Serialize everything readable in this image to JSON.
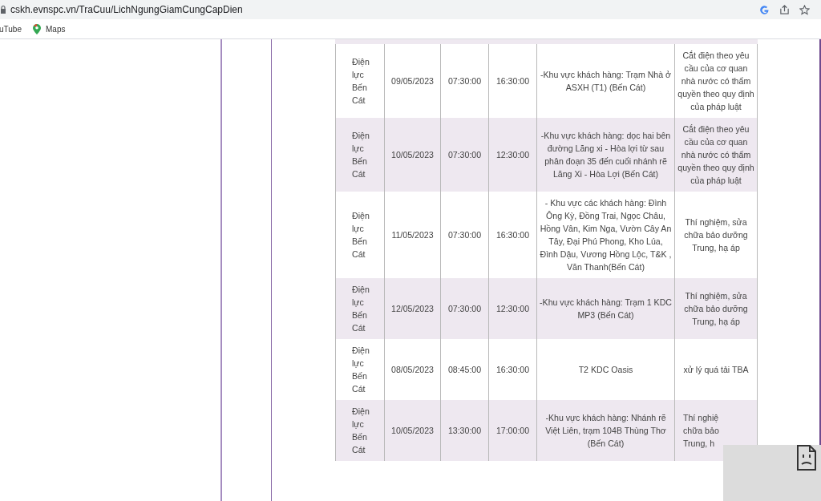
{
  "browser": {
    "url": "cskh.evnspc.vn/TraCuu/LichNgungGiamCungCapDien",
    "bookmarks": [
      {
        "label": "uTube",
        "kind": "plain"
      },
      {
        "label": "Maps",
        "kind": "maps"
      }
    ]
  },
  "table": {
    "rows": [
      {
        "unit": "Điện lực Bến Cát",
        "date": "09/05/2023",
        "start": "07:30:00",
        "end": "16:30:00",
        "area": "-Khu vực khách hàng: Trạm Nhà ở ASXH (T1) (Bến Cát)",
        "reason": "Cắt điện theo yêu cầu của cơ quan nhà nước có thẩm quyền theo quy định của pháp luật",
        "shaded": false
      },
      {
        "unit": "Điện lực Bến Cát",
        "date": "10/05/2023",
        "start": "07:30:00",
        "end": "12:30:00",
        "area": "-Khu vực khách hàng: dọc hai bên đường Lăng xi - Hòa lợi từ sau phân đoạn 35 đến cuối nhánh rẽ Lăng Xi - Hòa Lợi (Bến Cát)",
        "reason": "Cắt điện theo yêu cầu của cơ quan nhà nước có thẩm quyền theo quy định của pháp luật",
        "shaded": true
      },
      {
        "unit": "Điện lực Bến Cát",
        "date": "11/05/2023",
        "start": "07:30:00",
        "end": "16:30:00",
        "area": "- Khu vực các khách hàng: Đình Ông Kỳ, Đồng Trai, Ngọc Châu, Hồng Vân, Kim Nga, Vườn Cây An Tây, Đại Phú Phong, Kho Lúa, Đình Dậu, Vương Hồng Lộc, T&K , Văn Thanh(Bến Cát)",
        "reason": "Thí nghiệm, sửa chữa bảo dưỡng Trung, hạ áp",
        "shaded": false
      },
      {
        "unit": "Điện lực Bến Cát",
        "date": "12/05/2023",
        "start": "07:30:00",
        "end": "12:30:00",
        "area": "-Khu vực khách hàng: Trạm 1 KDC MP3 (Bến Cát)",
        "reason": "Thí nghiệm, sửa chữa bảo dưỡng Trung, hạ áp",
        "shaded": true
      },
      {
        "unit": "Điện lực Bến Cát",
        "date": "08/05/2023",
        "start": "08:45:00",
        "end": "16:30:00",
        "area": "T2 KDC Oasis",
        "reason": "xử lý quá tải TBA",
        "shaded": false
      },
      {
        "unit": "Điện lực Bến Cát",
        "date": "10/05/2023",
        "start": "13:30:00",
        "end": "17:00:00",
        "area": "-Khu vực khách hàng: Nhánh rẽ Việt Liên, trạm 104B Thùng Thơ (Bến Cát)",
        "reason": "Thí nghiệ\nchữa bảo\nTrung, h",
        "shaded": true,
        "covered": true
      }
    ]
  }
}
